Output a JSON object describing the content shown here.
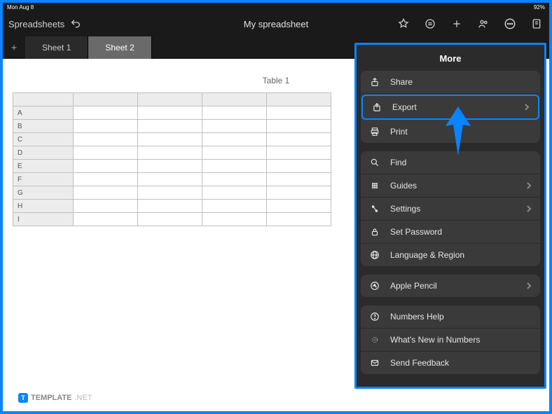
{
  "status_bar": {
    "left": "Mon Aug 8",
    "right": "92%"
  },
  "header": {
    "back_label": "Spreadsheets",
    "title": "My spreadsheet"
  },
  "tabs": [
    {
      "label": "Sheet 1",
      "active": false
    },
    {
      "label": "Sheet 2",
      "active": true
    }
  ],
  "table": {
    "title": "Table 1",
    "rows": [
      "A",
      "B",
      "C",
      "D",
      "E",
      "F",
      "G",
      "H",
      "I"
    ],
    "columns": 4
  },
  "more_panel": {
    "title": "More",
    "groups": [
      [
        {
          "id": "share",
          "label": "Share",
          "icon": "share-icon",
          "chevron": false,
          "highlighted": false
        },
        {
          "id": "export",
          "label": "Export",
          "icon": "export-icon",
          "chevron": true,
          "highlighted": true
        },
        {
          "id": "print",
          "label": "Print",
          "icon": "print-icon",
          "chevron": false,
          "highlighted": false
        }
      ],
      [
        {
          "id": "find",
          "label": "Find",
          "icon": "search-icon",
          "chevron": false,
          "highlighted": false
        },
        {
          "id": "guides",
          "label": "Guides",
          "icon": "grid-icon",
          "chevron": true,
          "highlighted": false
        },
        {
          "id": "settings",
          "label": "Settings",
          "icon": "settings-icon",
          "chevron": true,
          "highlighted": false
        },
        {
          "id": "set-password",
          "label": "Set Password",
          "icon": "lock-icon",
          "chevron": false,
          "highlighted": false
        },
        {
          "id": "language",
          "label": "Language & Region",
          "icon": "globe-icon",
          "chevron": false,
          "highlighted": false
        }
      ],
      [
        {
          "id": "apple-pencil",
          "label": "Apple Pencil",
          "icon": "pencil-icon",
          "chevron": true,
          "highlighted": false
        }
      ],
      [
        {
          "id": "help",
          "label": "Numbers Help",
          "icon": "help-icon",
          "chevron": false,
          "highlighted": false
        },
        {
          "id": "whats-new",
          "label": "What's New in Numbers",
          "icon": "sparkle-icon",
          "chevron": false,
          "highlighted": false
        },
        {
          "id": "feedback",
          "label": "Send Feedback",
          "icon": "mail-icon",
          "chevron": false,
          "highlighted": false
        }
      ]
    ]
  },
  "watermark": {
    "badge": "T",
    "label": "TEMPLATE",
    "suffix": ".NET"
  },
  "colors": {
    "accent": "#0a84ff"
  }
}
